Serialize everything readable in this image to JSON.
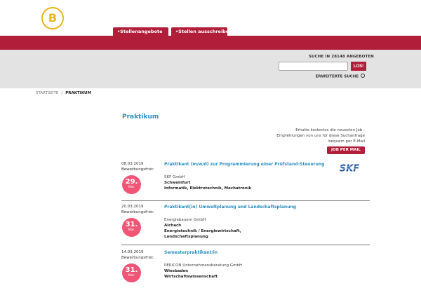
{
  "brand": {
    "logo_letter": "B",
    "logo_color": "#e8b51c",
    "accent": "#b01e3a",
    "link_color": "#2a8ec2",
    "deadline_color": "#f05575"
  },
  "nav": {
    "tabs": [
      {
        "label": "•Stellenangebote"
      },
      {
        "label": "•Stellen ausschreiben"
      }
    ]
  },
  "search": {
    "label": "SUCHE IN 28148 ANGEBOTEN",
    "value": "",
    "placeholder": "",
    "button": "LOS!",
    "advanced": "ERWEITERTE SUCHE"
  },
  "breadcrumb": {
    "home": "STARTSEITE",
    "separator": "/",
    "current": "PRAKTIKUM"
  },
  "page": {
    "title": "Praktikum"
  },
  "alert": {
    "text": "Erhalte kostenlos die neuesten Job - Empfehlungen von uns für diese Suchanfrage bequem per E-Mail",
    "button": "JOB PER MAIL"
  },
  "jobs": [
    {
      "date": "08.03.2019",
      "frist_label": "Bewerbungsfrist:",
      "deadline_day": "29.",
      "deadline_month": "Mar.",
      "title": "Praktikant (m/w/d) zur Programmierung einer Prüfstand-Steuerung",
      "company": "SKF GmbH",
      "location": "Schweinfurt",
      "fields": [
        "Informatik, Elektrotechnik, Mechatronik"
      ],
      "logo_text": "SKF",
      "logo_icon": "skf-logo"
    },
    {
      "date": "20.03.2019",
      "frist_label": "Bewerbungsfrist:",
      "deadline_day": "31.",
      "deadline_month": "Mar.",
      "title": "Praktikant(in) Umweltplanung und Landschaftsplanung",
      "company": "Energiebauern GmbH",
      "location": "Aichach",
      "fields": [
        "Energietechnik / Energiewirtschaft,",
        "Landschaftsplanung"
      ]
    },
    {
      "date": "14.03.2019",
      "frist_label": "Bewerbungsfrist:",
      "deadline_day": "31.",
      "deadline_month": "Mar.",
      "title": "Semesterpraktikant/in",
      "company": "PERICON Unternehmensberatung GmbH",
      "location": "Wiesbaden",
      "fields": [
        "Wirtschaftswissenschaft"
      ]
    }
  ]
}
